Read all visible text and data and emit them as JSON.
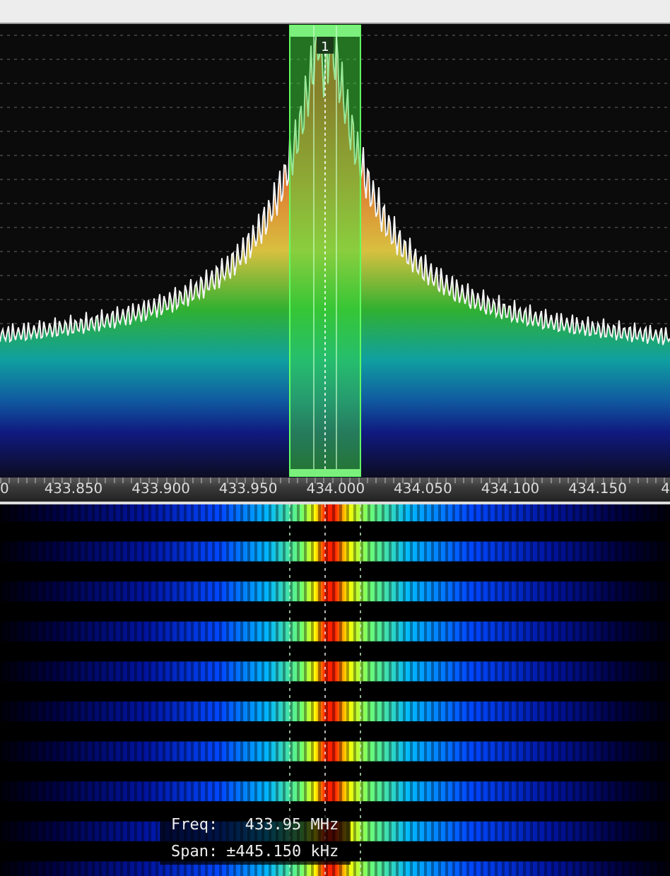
{
  "spectrum": {
    "marker": "1"
  },
  "axis": {
    "labels": [
      "0",
      "433.850",
      "433.900",
      "433.950",
      "434.000",
      "434.050",
      "434.100",
      "434.150",
      "4"
    ]
  },
  "tooltip": {
    "rows": [
      {
        "label": "Freq:",
        "value": "433.95 MHz"
      },
      {
        "label": "Span:",
        "value": "±445.150 kHz"
      }
    ]
  }
}
